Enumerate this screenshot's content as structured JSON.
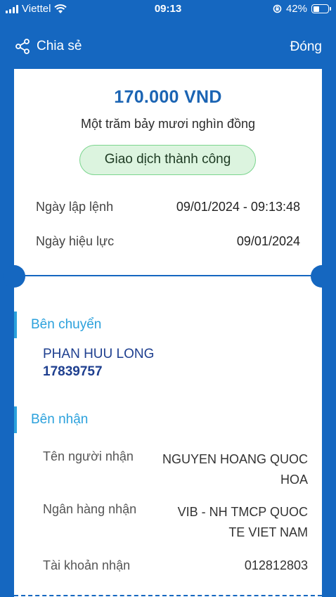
{
  "status_bar": {
    "carrier": "Viettel",
    "time": "09:13",
    "battery_percent": "42%",
    "battery_level": 0.42
  },
  "header": {
    "share_label": "Chia sẻ",
    "close_label": "Đóng"
  },
  "receipt": {
    "amount": "170.000 VND",
    "amount_words": "Một trăm bảy mươi nghìn đồng",
    "status": "Giao dịch thành công",
    "order_date_label": "Ngày lập lệnh",
    "order_date_value": "09/01/2024 - 09:13:48",
    "effective_date_label": "Ngày hiệu lực",
    "effective_date_value": "09/01/2024"
  },
  "sender": {
    "section_title": "Bên chuyển",
    "name": "PHAN HUU LONG",
    "account": "17839757"
  },
  "receiver": {
    "section_title": "Bên nhận",
    "name_label": "Tên người nhận",
    "name_line1": "NGUYEN HOANG QUOC",
    "name_line2": "HOA",
    "bank_label": "Ngân hàng nhận",
    "bank_line1": "VIB - NH TMCP QUOC",
    "bank_line2": "TE VIET NAM",
    "account_label": "Tài khoản nhận",
    "account_value": "012812803"
  },
  "colors": {
    "background": "#1567c0",
    "accent": "#2ba1dc",
    "amount": "#1b64b3",
    "success_bg": "#dcf4df",
    "success_border": "#7bd58e"
  }
}
